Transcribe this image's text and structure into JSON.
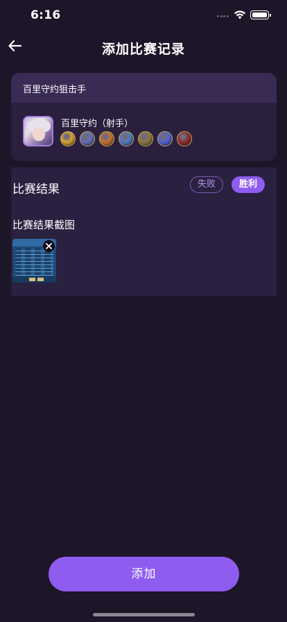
{
  "status_bar": {
    "time": "6:16"
  },
  "nav": {
    "title": "添加比赛记录"
  },
  "hero_card": {
    "header": "百里守约狙击手",
    "hero_name": "百里守约（射手）",
    "equipment": [
      {
        "icon": "item-icon-1",
        "color": "#d8a52e"
      },
      {
        "icon": "item-icon-2",
        "color": "#5d6fb8"
      },
      {
        "icon": "item-icon-3",
        "color": "#c4722b"
      },
      {
        "icon": "item-icon-4",
        "color": "#4a7cc4"
      },
      {
        "icon": "item-icon-5",
        "color": "#8a7a3c"
      },
      {
        "icon": "item-icon-6",
        "color": "#4b63d6"
      },
      {
        "icon": "item-icon-7",
        "color": "#8c2a2a"
      }
    ]
  },
  "result": {
    "label": "比赛结果",
    "lose_label": "失败",
    "win_label": "胜利",
    "selected": "胜利",
    "screenshot_label": "比赛结果截图"
  },
  "actions": {
    "add_label": "添加"
  },
  "colors": {
    "accent": "#8e5df0",
    "background": "#1d1528",
    "card": "#2a1f3d"
  }
}
